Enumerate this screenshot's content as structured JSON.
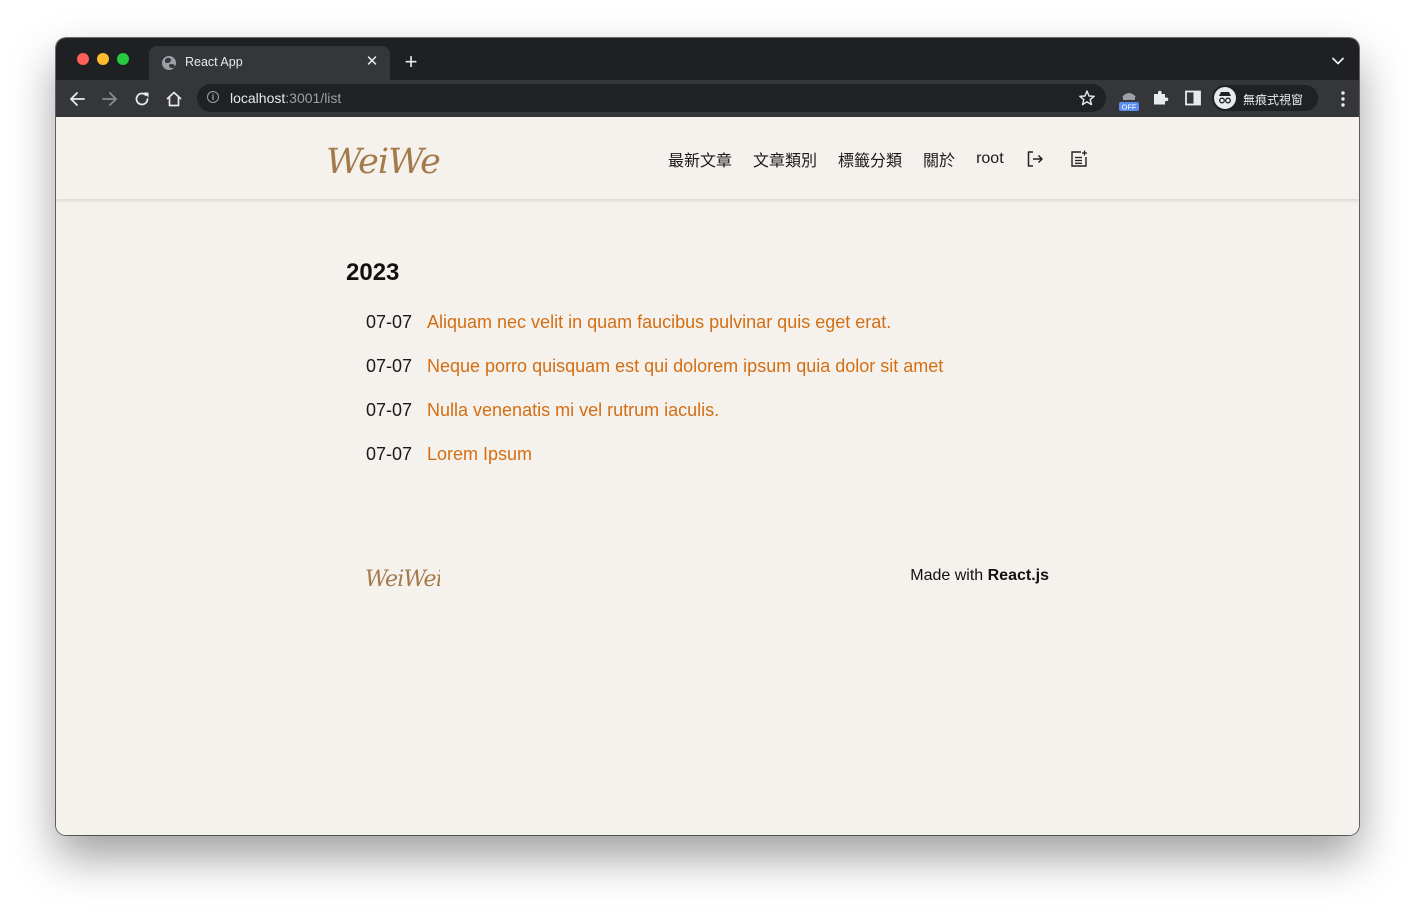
{
  "browser": {
    "tab_title": "React App",
    "url_host": "localhost",
    "url_rest": ":3001/list",
    "extension_badge": "OFF",
    "profile_label": "無痕式視窗"
  },
  "site": {
    "logo_text": "WeiWei",
    "nav": {
      "items": [
        "最新文章",
        "文章類別",
        "標籤分類",
        "關於",
        "root"
      ],
      "icons": [
        "logout-icon",
        "new-post-icon"
      ]
    }
  },
  "archive": {
    "year": "2023",
    "posts": [
      {
        "date": "07-07",
        "title": "Aliquam nec velit in quam faucibus pulvinar quis eget erat."
      },
      {
        "date": "07-07",
        "title": "Neque porro quisquam est qui dolorem ipsum quia dolor sit amet"
      },
      {
        "date": "07-07",
        "title": "Nulla venenatis mi vel rutrum iaculis."
      },
      {
        "date": "07-07",
        "title": "Lorem Ipsum"
      }
    ]
  },
  "footer": {
    "logo_text": "WeiWei",
    "made_with_prefix": "Made with",
    "made_with_tech": "React.js"
  },
  "colors": {
    "accent_link": "#d46e13",
    "logo": "#a57a4a",
    "page_bg": "#f5f2ee",
    "chrome_dark": "#1f2023"
  }
}
